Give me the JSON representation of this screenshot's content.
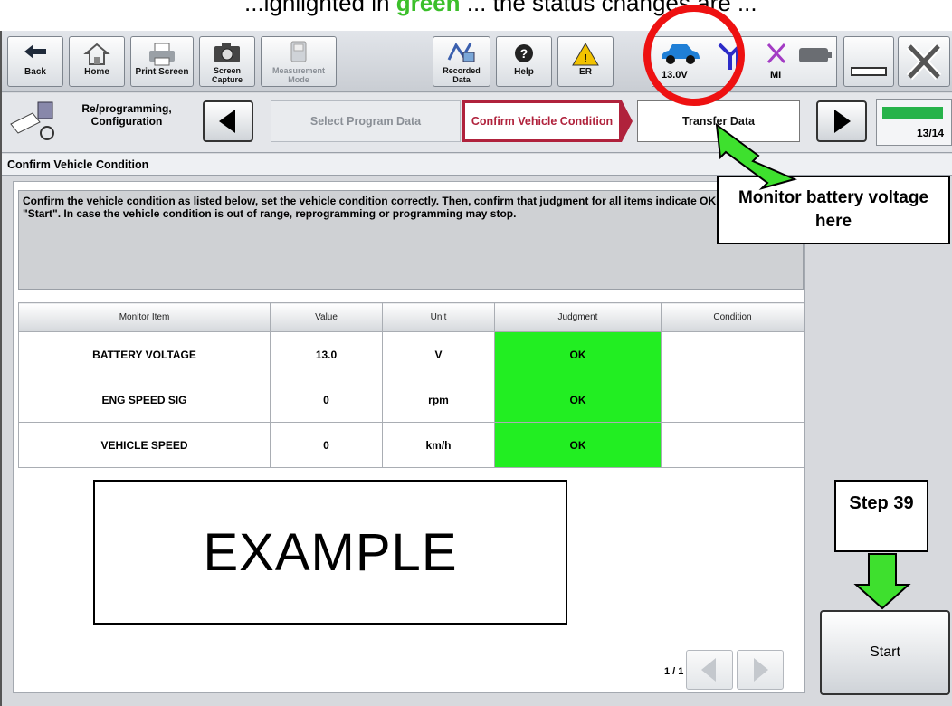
{
  "top_text": {
    "prefix": "...ighlighted in",
    "green": "green",
    "suffix": "... the status changes are ..."
  },
  "toolbar": {
    "back": "Back",
    "home": "Home",
    "print_screen": "Print Screen",
    "screen_capture": "Screen Capture",
    "measurement_mode": "Measurement Mode",
    "recorded_data": "Recorded Data",
    "help": "Help",
    "er": "ER",
    "voltage": "13.0V",
    "mi": "MI"
  },
  "breadcrumb": {
    "root": "Re/programming, Configuration",
    "prev_step": "Select Program Data",
    "current_step": "Confirm Vehicle Condition",
    "next_step": "Transfer Data",
    "progress_text": "13/14",
    "progress_fraction": 0.93
  },
  "section_title": "Confirm Vehicle Condition",
  "instructions": "Confirm the vehicle condition as listed below, set the vehicle condition correctly. Then, confirm that judgment for all items indicate OK, and touch \"Start\". In case the vehicle condition is out of range, reprogramming or programming may stop.",
  "table": {
    "headers": [
      "Monitor Item",
      "Value",
      "Unit",
      "Judgment",
      "Condition"
    ],
    "rows": [
      {
        "item": "BATTERY VOLTAGE",
        "value": "13.0",
        "unit": "V",
        "judgment": "OK",
        "condition": ""
      },
      {
        "item": "ENG SPEED SIG",
        "value": "0",
        "unit": "rpm",
        "judgment": "OK",
        "condition": ""
      },
      {
        "item": "VEHICLE SPEED",
        "value": "0",
        "unit": "km/h",
        "judgment": "OK",
        "condition": ""
      }
    ]
  },
  "pager": "1 / 1",
  "start_button": "Start",
  "annotations": {
    "example": "EXAMPLE",
    "callout": "Monitor battery voltage here",
    "step": "Step 39"
  },
  "colors": {
    "ok_green": "#22ee22",
    "current_step_red": "#b0223c",
    "arrow_green": "#3ee02e",
    "circle_red": "#ee1111"
  }
}
